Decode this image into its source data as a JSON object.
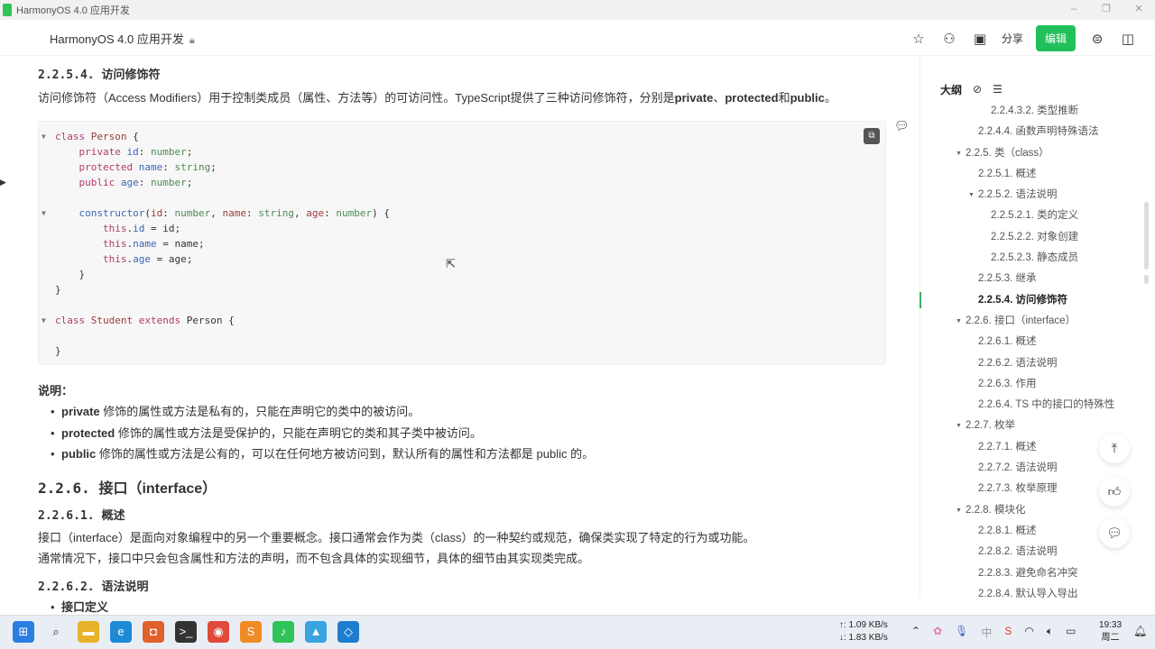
{
  "window": {
    "title": "HarmonyOS 4.0 应用开发",
    "controls": [
      "–",
      "❐",
      "✕"
    ]
  },
  "header": {
    "doc_title": "HarmonyOS 4.0 应用开发",
    "share_label": "分享",
    "edit_label": "编辑"
  },
  "content": {
    "section_title_num": "2.2.5.4.",
    "section_title": "访问修饰符",
    "intro_parts": [
      "访问修饰符（Access Modifiers）用于控制类成员（属性、方法等）的可访问性。TypeScript提供了三种访问修饰符，分别是",
      "private",
      "、",
      "protected",
      "和",
      "public",
      "。"
    ],
    "code": [
      {
        "fold": true,
        "tokens": [
          [
            "class ",
            "kw"
          ],
          [
            "Person ",
            "pm"
          ],
          [
            "{",
            ""
          ]
        ]
      },
      {
        "fold": false,
        "tokens": [
          [
            "    private ",
            "kw"
          ],
          [
            "id",
            "pr"
          ],
          [
            ": ",
            ""
          ],
          [
            "number",
            "ty"
          ],
          [
            ";",
            ""
          ]
        ]
      },
      {
        "fold": false,
        "tokens": [
          [
            "    protected ",
            "kw"
          ],
          [
            "name",
            "pr"
          ],
          [
            ": ",
            ""
          ],
          [
            "string",
            "ty"
          ],
          [
            ";",
            ""
          ]
        ]
      },
      {
        "fold": false,
        "tokens": [
          [
            "    public ",
            "kw"
          ],
          [
            "age",
            "pr"
          ],
          [
            ": ",
            ""
          ],
          [
            "number",
            "ty"
          ],
          [
            ";",
            ""
          ]
        ]
      },
      {
        "fold": false,
        "tokens": []
      },
      {
        "fold": true,
        "tokens": [
          [
            "    ",
            ""
          ],
          [
            "constructor",
            "fn"
          ],
          [
            "(",
            ""
          ],
          [
            "id",
            "pm"
          ],
          [
            ": ",
            ""
          ],
          [
            "number",
            "ty"
          ],
          [
            ", ",
            ""
          ],
          [
            "name",
            "pm"
          ],
          [
            ": ",
            ""
          ],
          [
            "string",
            "ty"
          ],
          [
            ", ",
            ""
          ],
          [
            "age",
            "pm"
          ],
          [
            ": ",
            ""
          ],
          [
            "number",
            "ty"
          ],
          [
            ") {",
            ""
          ]
        ]
      },
      {
        "fold": false,
        "tokens": [
          [
            "        this",
            "kw"
          ],
          [
            ".",
            ""
          ],
          [
            "id",
            "pr"
          ],
          [
            " = id;",
            ""
          ]
        ]
      },
      {
        "fold": false,
        "tokens": [
          [
            "        this",
            "kw"
          ],
          [
            ".",
            ""
          ],
          [
            "name",
            "pr"
          ],
          [
            " = name;",
            ""
          ]
        ]
      },
      {
        "fold": false,
        "tokens": [
          [
            "        this",
            "kw"
          ],
          [
            ".",
            ""
          ],
          [
            "age",
            "pr"
          ],
          [
            " = age;",
            ""
          ]
        ]
      },
      {
        "fold": false,
        "tokens": [
          [
            "    }",
            ""
          ]
        ]
      },
      {
        "fold": false,
        "tokens": [
          [
            "}",
            ""
          ]
        ]
      },
      {
        "fold": false,
        "tokens": []
      },
      {
        "fold": true,
        "tokens": [
          [
            "class ",
            "kw"
          ],
          [
            "Student ",
            "pm"
          ],
          [
            "extends ",
            "kw"
          ],
          [
            "Person {",
            ""
          ]
        ]
      },
      {
        "fold": false,
        "tokens": []
      },
      {
        "fold": false,
        "tokens": [
          [
            "}",
            ""
          ]
        ]
      }
    ],
    "note_heading": "说明：",
    "notes": [
      {
        "kw": "private",
        "text": " 修饰的属性或方法是私有的，只能在声明它的类中的被访问。"
      },
      {
        "kw": "protected",
        "text": " 修饰的属性或方法是受保护的，只能在声明它的类和其子类中被访问。"
      },
      {
        "kw": "public",
        "text": " 修饰的属性或方法是公有的，可以在任何地方被访问到，默认所有的属性和方法都是 public 的。"
      }
    ],
    "h226_num": "2.2.6.",
    "h226": "接口（interface）",
    "h2261_num": "2.2.6.1.",
    "h2261": "概述",
    "p1": "接口（interface）是面向对象编程中的另一个重要概念。接口通常会作为类（class）的一种契约或规范，确保类实现了特定的行为或功能。",
    "p2": "通常情况下，接口中只会包含属性和方法的声明，而不包含具体的实现细节，具体的细节由其实现类完成。",
    "h2262_num": "2.2.6.2.",
    "h2262": "语法说明",
    "bullet_last": "接口定义"
  },
  "outline": {
    "heading": "大纲",
    "items": [
      {
        "label": "2.2.4.3.2. 类型推断",
        "level": 3
      },
      {
        "label": "2.2.4.4. 函数声明特殊语法",
        "level": 2
      },
      {
        "label": "2.2.5. 类（class）",
        "level": 1,
        "caret": true
      },
      {
        "label": "2.2.5.1. 概述",
        "level": 2
      },
      {
        "label": "2.2.5.2. 语法说明",
        "level": 2,
        "caret": true
      },
      {
        "label": "2.2.5.2.1. 类的定义",
        "level": 3
      },
      {
        "label": "2.2.5.2.2. 对象创建",
        "level": 3
      },
      {
        "label": "2.2.5.2.3. 静态成员",
        "level": 3
      },
      {
        "label": "2.2.5.3. 继承",
        "level": 2
      },
      {
        "label": "2.2.5.4. 访问修饰符",
        "level": 2,
        "active": true
      },
      {
        "label": "2.2.6. 接口（interface）",
        "level": 1,
        "caret": true
      },
      {
        "label": "2.2.6.1. 概述",
        "level": 2
      },
      {
        "label": "2.2.6.2. 语法说明",
        "level": 2
      },
      {
        "label": "2.2.6.3. 作用",
        "level": 2
      },
      {
        "label": "2.2.6.4. TS 中的接口的特殊性",
        "level": 2
      },
      {
        "label": "2.2.7. 枚举",
        "level": 1,
        "caret": true
      },
      {
        "label": "2.2.7.1. 概述",
        "level": 2
      },
      {
        "label": "2.2.7.2. 语法说明",
        "level": 2
      },
      {
        "label": "2.2.7.3. 枚举原理",
        "level": 2
      },
      {
        "label": "2.2.8. 模块化",
        "level": 1,
        "caret": true
      },
      {
        "label": "2.2.8.1. 概述",
        "level": 2
      },
      {
        "label": "2.2.8.2. 语法说明",
        "level": 2
      },
      {
        "label": "2.2.8.3. 避免命名冲突",
        "level": 2
      },
      {
        "label": "2.2.8.4. 默认导入导出",
        "level": 2
      }
    ]
  },
  "taskbar": {
    "net_up": "↑: 1.09 KB/s",
    "net_down": "↓: 1.83 KB/s",
    "time": "19:33",
    "day": "周二",
    "apps": [
      {
        "name": "windows-start",
        "glyph": "⊞",
        "color": "#2a7de1"
      },
      {
        "name": "search",
        "glyph": "⌕",
        "color": "#222"
      },
      {
        "name": "file-explorer",
        "glyph": "▬",
        "color": "#e8b32a"
      },
      {
        "name": "edge",
        "glyph": "e",
        "color": "#1d8ad6"
      },
      {
        "name": "office",
        "glyph": "◘",
        "color": "#e1602b"
      },
      {
        "name": "terminal",
        "glyph": ">_",
        "color": "#333"
      },
      {
        "name": "chrome",
        "glyph": "◉",
        "color": "#e04a3a"
      },
      {
        "name": "sublime",
        "glyph": "S",
        "color": "#f08a24"
      },
      {
        "name": "harmony-app",
        "glyph": "♪",
        "color": "#2fc35a"
      },
      {
        "name": "cloud-app",
        "glyph": "▲",
        "color": "#3aa4e0"
      },
      {
        "name": "vscode",
        "glyph": "◇",
        "color": "#1f7dd0"
      }
    ]
  },
  "colors": {
    "accent": "#22c05a",
    "keyword": "#b03a6e",
    "property": "#3b67b5",
    "type": "#4f8a57"
  }
}
